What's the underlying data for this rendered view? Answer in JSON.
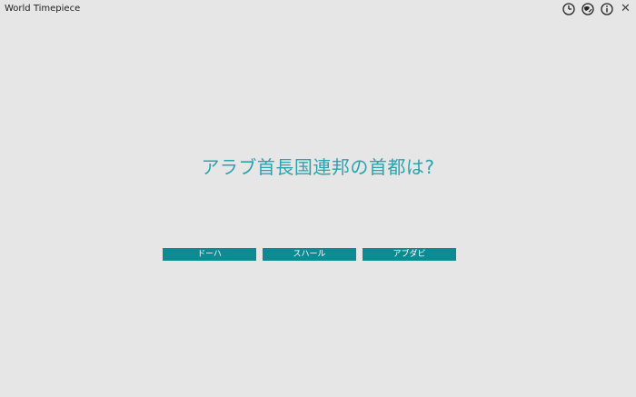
{
  "window": {
    "title": "World Timepiece",
    "controls": [
      {
        "name": "clock-icon"
      },
      {
        "name": "globe-icon"
      },
      {
        "name": "info-icon"
      },
      {
        "name": "close-icon",
        "glyph": "✕"
      }
    ]
  },
  "quiz": {
    "question": "アラブ首長国連邦の首都は?",
    "answers": [
      "ドーハ",
      "スハール",
      "アブダビ"
    ]
  },
  "colors": {
    "background": "#e6e6e6",
    "question_text": "#2aa3ad",
    "answer_button": "#0e8a92",
    "answer_text": "#ffffff"
  }
}
